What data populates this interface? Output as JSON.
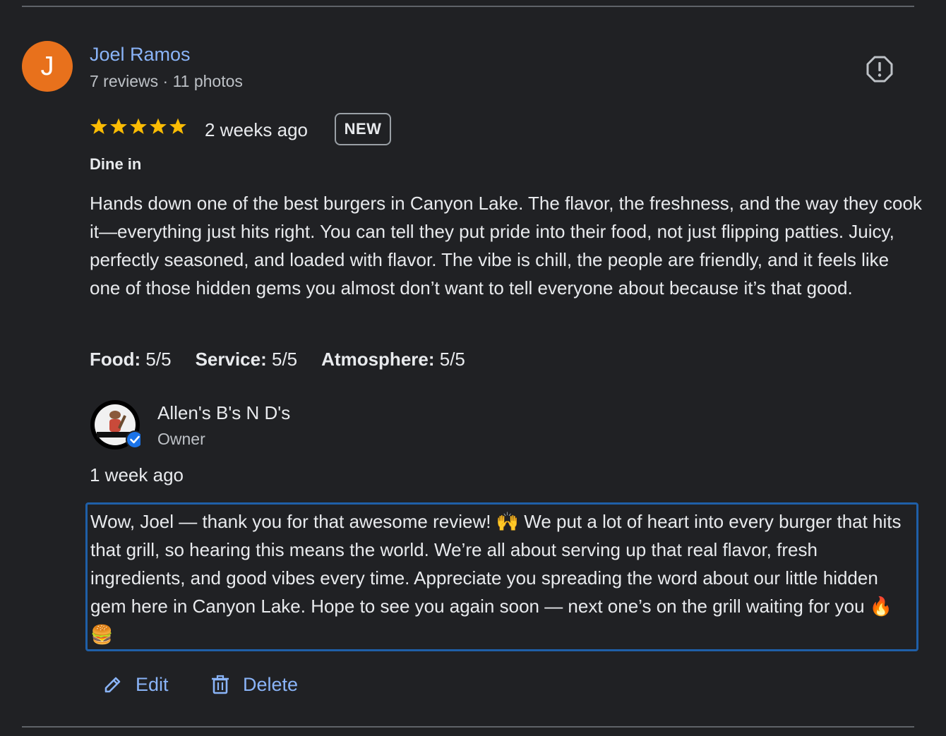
{
  "review": {
    "reviewer_initial": "J",
    "reviewer_name": "Joel Ramos",
    "reviewer_meta": "7 reviews · 11 photos",
    "rating": 5,
    "time_ago": "2 weeks ago",
    "badge": "NEW",
    "service_type": "Dine in",
    "text": "Hands down one of the best burgers in Canyon Lake. The flavor, the freshness, and the way they cook it—everything just hits right. You can tell they put pride into their food, not just flipping patties. Juicy, perfectly seasoned, and loaded with flavor. The vibe is chill, the people are friendly, and it feels like one of those hidden gems you almost don’t want to tell everyone about because it’s that good.",
    "ratings": [
      {
        "label": "Food:",
        "value": "5/5"
      },
      {
        "label": "Service:",
        "value": "5/5"
      },
      {
        "label": "Atmosphere:",
        "value": "5/5"
      }
    ]
  },
  "reply": {
    "owner_name": "Allen's B's N D's",
    "owner_role": "Owner",
    "time_ago": "1 week ago",
    "text": "Wow, Joel — thank you for that awesome review! 🙌 We put a lot of heart into every burger that hits that grill, so hearing this means the world. We’re all about serving up that real flavor, fresh ingredients, and good vibes every time. Appreciate you spreading the word about our little hidden gem here in Canyon Lake. Hope to see you again soon — next one’s on the grill waiting for you 🔥🍔"
  },
  "actions": {
    "edit_label": "Edit",
    "delete_label": "Delete"
  },
  "colors": {
    "background": "#202124",
    "link": "#8ab4f8",
    "avatar": "#e8711c",
    "star": "#fbbc04",
    "focus_border": "#1f5fa8",
    "verified": "#1a73e8"
  },
  "icons": {
    "report": "report-flag-icon",
    "star": "star-icon",
    "edit": "pencil-icon",
    "delete": "trash-icon",
    "verified": "verified-check-icon"
  }
}
